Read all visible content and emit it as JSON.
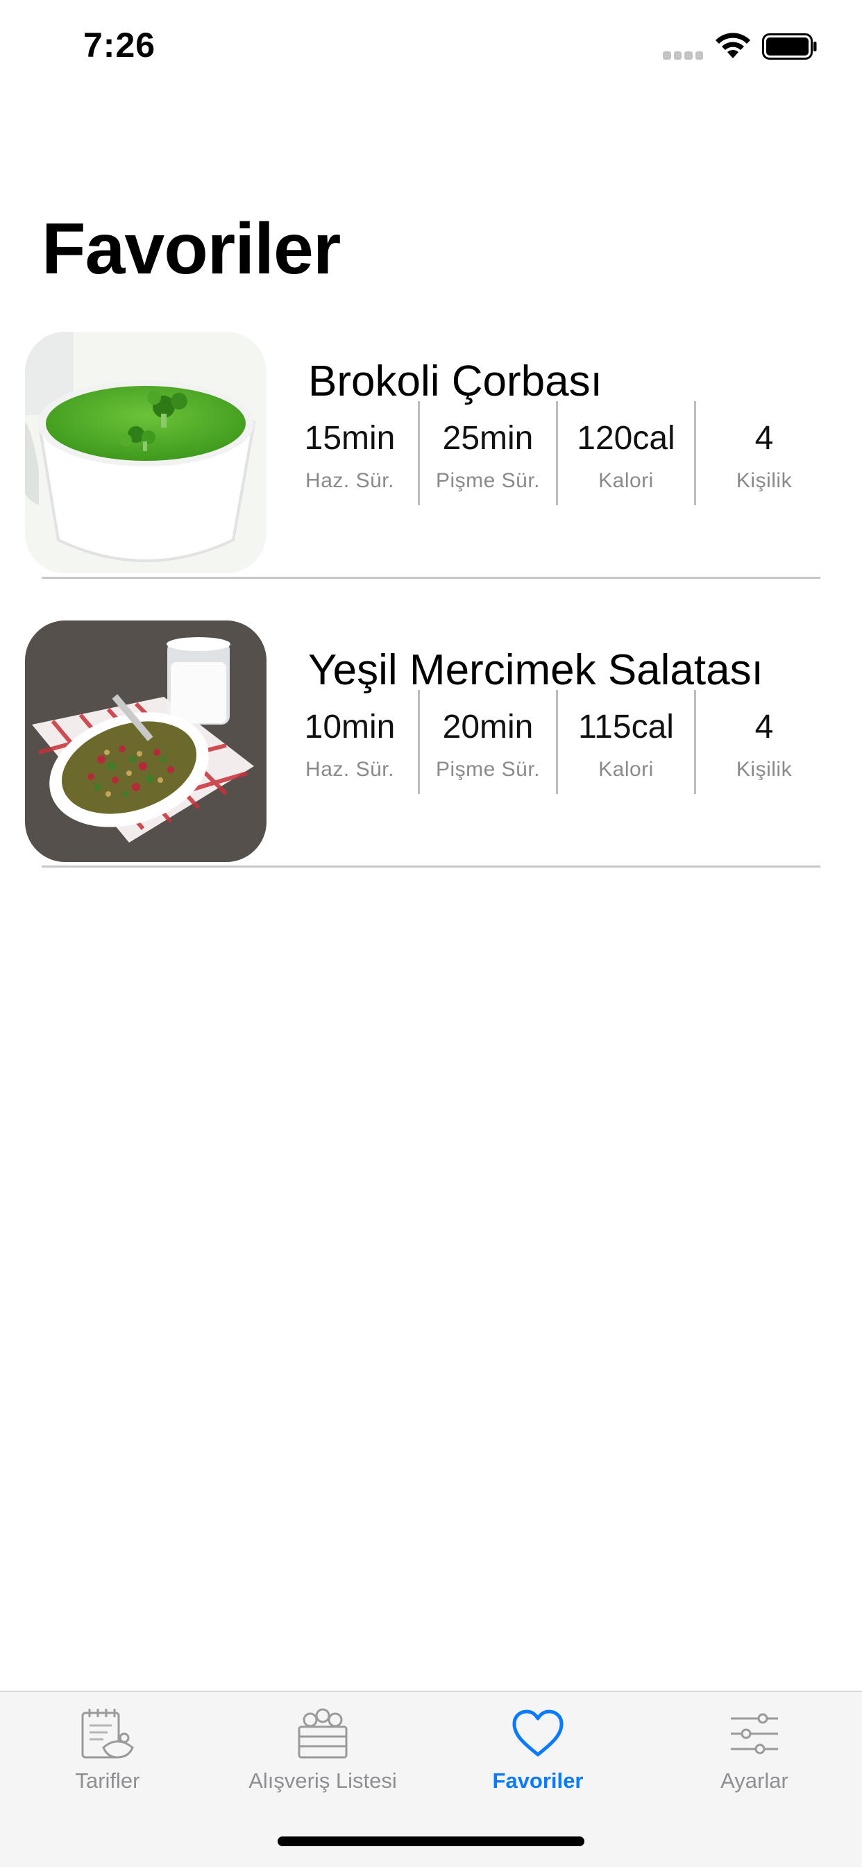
{
  "status_bar": {
    "time": "7:26"
  },
  "page": {
    "title": "Favoriler"
  },
  "recipes": [
    {
      "name": "Brokoli Çorbası",
      "image": "broccoli-soup-photo",
      "stats": [
        {
          "value": "15min",
          "label": "Haz. Sür."
        },
        {
          "value": "25min",
          "label": "Pişme Sür."
        },
        {
          "value": "120cal",
          "label": "Kalori"
        },
        {
          "value": "4",
          "label": "Kişilik"
        }
      ]
    },
    {
      "name": "Yeşil Mercimek Salatası",
      "image": "lentil-salad-photo",
      "stats": [
        {
          "value": "10min",
          "label": "Haz. Sür."
        },
        {
          "value": "20min",
          "label": "Pişme Sür."
        },
        {
          "value": "115cal",
          "label": "Kalori"
        },
        {
          "value": "4",
          "label": "Kişilik"
        }
      ]
    }
  ],
  "tab_bar": {
    "tabs": [
      {
        "label": "Tarifler",
        "icon": "recipe-book-icon"
      },
      {
        "label": "Alışveriş Listesi",
        "icon": "grocery-crate-icon"
      },
      {
        "label": "Favoriler",
        "icon": "heart-icon"
      },
      {
        "label": "Ayarlar",
        "icon": "sliders-icon"
      }
    ],
    "active_color": "#0a7aff",
    "inactive_color": "#8e8e93"
  }
}
